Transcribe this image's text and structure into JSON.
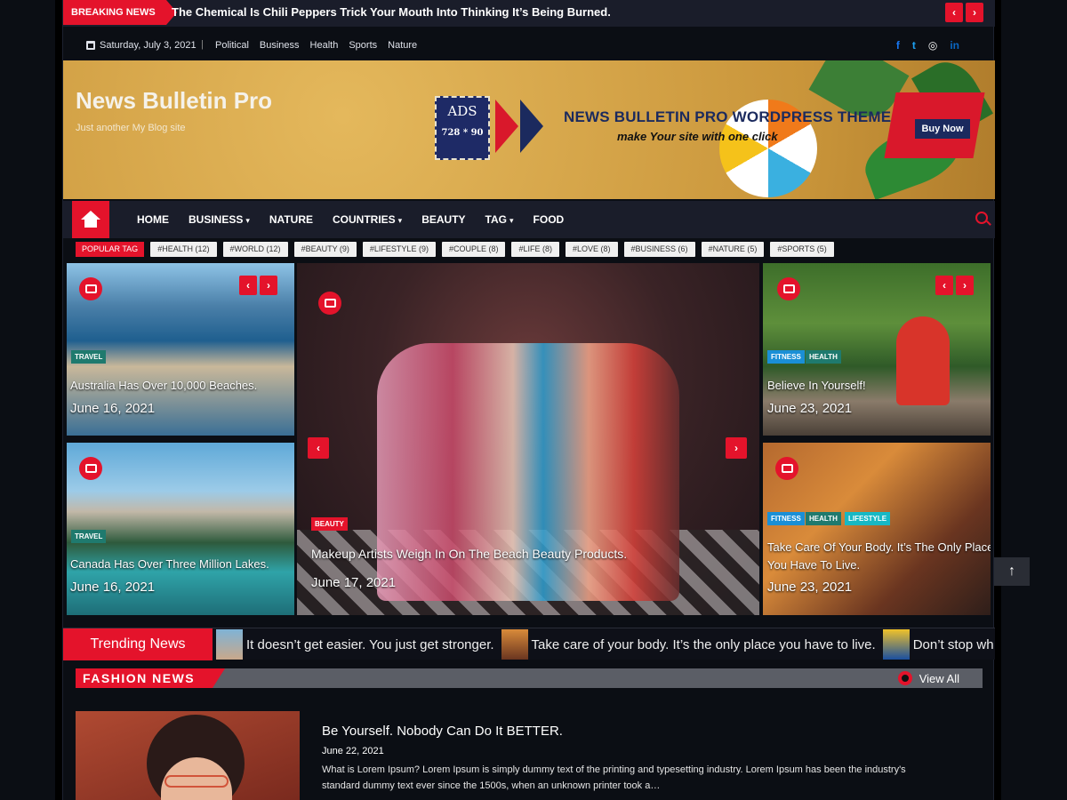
{
  "breaking": {
    "label": "BREAKING NEWS",
    "headline": "The Chemical Is Chili Peppers Trick Your Mouth Into Thinking It’s Being Burned.",
    "prev": "‹",
    "next": "›"
  },
  "topbar": {
    "date": "Saturday, July 3, 2021",
    "separator": "|",
    "links": [
      "Political",
      "Business",
      "Health",
      "Sports",
      "Nature"
    ],
    "social": [
      {
        "icon": "facebook-icon",
        "glyph": "f",
        "color": "#1877f2"
      },
      {
        "icon": "twitter-icon",
        "glyph": "t",
        "color": "#1da1f2"
      },
      {
        "icon": "instagram-icon",
        "glyph": "◎",
        "color": "#ffffff"
      },
      {
        "icon": "linkedin-icon",
        "glyph": "in",
        "color": "#0a66c2"
      }
    ]
  },
  "header": {
    "site_title": "News Bulletin Pro",
    "tagline": "Just another My Blog site",
    "ad": {
      "stamp_top": "ADS",
      "stamp_bottom": "728 * 90",
      "title": "NEWS BULLETIN PRO WORDPRESS THEME",
      "subtitle": "make Your site with one click",
      "button": "Buy Now"
    }
  },
  "nav": {
    "items": [
      {
        "label": "HOME",
        "dropdown": false
      },
      {
        "label": "BUSINESS",
        "dropdown": true
      },
      {
        "label": "NATURE",
        "dropdown": false
      },
      {
        "label": "COUNTRIES",
        "dropdown": true
      },
      {
        "label": "BEAUTY",
        "dropdown": false
      },
      {
        "label": "TAG",
        "dropdown": true
      },
      {
        "label": "FOOD",
        "dropdown": false
      }
    ],
    "caret": "▾"
  },
  "popular_tags": {
    "label": "POPULAR TAG",
    "tags": [
      "#HEALTH (12)",
      "#WORLD (12)",
      "#BEAUTY (9)",
      "#LIFESTYLE (9)",
      "#COUPLE (8)",
      "#LIFE (8)",
      "#LOVE (8)",
      "#BUSINESS (6)",
      "#NATURE (5)",
      "#SPORTS (5)"
    ]
  },
  "grid": {
    "card1": {
      "categories": [
        "TRAVEL"
      ],
      "title": "Australia Has Over 10,000 Beaches.",
      "date": "June 16, 2021"
    },
    "card2": {
      "categories": [
        "TRAVEL"
      ],
      "title": "Canada Has Over Three Million Lakes.",
      "date": "June 16, 2021"
    },
    "main": {
      "categories": [
        "BEAUTY"
      ],
      "title": "Makeup Artists Weigh In On The Beach Beauty Products.",
      "date": "June 17, 2021"
    },
    "card3": {
      "categories": [
        "FITNESS",
        "HEALTH"
      ],
      "title": "Believe In Yourself!",
      "date": "June 23, 2021"
    },
    "card4": {
      "categories": [
        "FITNESS",
        "HEALTH",
        "LIFESTYLE"
      ],
      "title": "Take Care Of Your Body. It’s The Only Place You Have To Live.",
      "date": "June 23, 2021"
    },
    "category_colors": {
      "TRAVEL": "#1f7a6e",
      "BEAUTY": "#e4132b",
      "FITNESS": "#1a8fd6",
      "HEALTH": "#1f7a6e",
      "LIFESTYLE": "#17b8c4"
    }
  },
  "trending": {
    "label": "Trending News",
    "items": [
      "It doesn’t get easier. You just get stronger.",
      "Take care of your body. It’s the only place you have to live.",
      "Don’t stop when you ar"
    ]
  },
  "fashion": {
    "section_title": "FASHION NEWS",
    "view_all": "View All",
    "post": {
      "title": "Be Yourself. Nobody Can Do It BETTER.",
      "date": "June 22, 2021",
      "excerpt": "What is Lorem Ipsum? Lorem Ipsum is simply dummy text of the printing and typesetting industry. Lorem Ipsum has been the industry's standard dummy text ever since the 1500s, when an unknown printer took a…"
    }
  },
  "scroll_top": "↑",
  "colors": {
    "accent": "#e4132b",
    "nav_bg": "#1a1d2a",
    "page_bg": "#0b0e14"
  }
}
